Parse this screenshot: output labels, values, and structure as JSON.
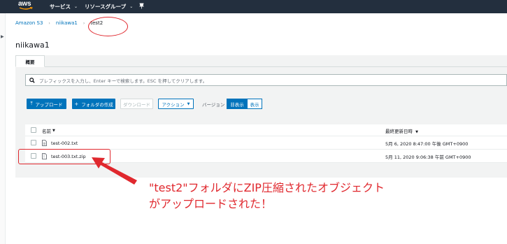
{
  "nav": {
    "logo_text": "aws",
    "services": "サービス",
    "resource_groups": "リソースグループ",
    "chevron": "⌄",
    "pin_icon": "pin-icon"
  },
  "breadcrumb": {
    "items": [
      "Amazon S3",
      "niikawa1",
      "test2"
    ],
    "separator": "›"
  },
  "page_title": "niikawa1",
  "tabs": [
    {
      "label": "概要"
    }
  ],
  "search": {
    "placeholder": "プレフィックスを入力し、Enter キーで検索します。ESC を押してクリアします。"
  },
  "toolbar": {
    "upload": "アップロード",
    "create_folder": "フォルダの作成",
    "download": "ダウンロード",
    "actions": "アクション",
    "version_label": "バージョン",
    "hide": "非表示",
    "show": "表示"
  },
  "table": {
    "headers": {
      "name": "名前",
      "last_modified": "最終更新日時"
    },
    "rows": [
      {
        "name": "test-002.txt",
        "last_modified": "5月 6, 2020 8:47:00 午後 GMT+0900"
      },
      {
        "name": "test-003.txt.zip",
        "last_modified": "5月 11, 2020 9:06:38 午前 GMT+0900"
      }
    ]
  },
  "annotation": {
    "line1": "\"test2\"フォルダにZIP圧縮されたオブジェクト",
    "line2": "がアップロードされた！"
  },
  "colors": {
    "nav_bg": "#232f3e",
    "primary": "#0073bb",
    "annotation": "#e0282e",
    "aws_smile": "#ff9900"
  }
}
